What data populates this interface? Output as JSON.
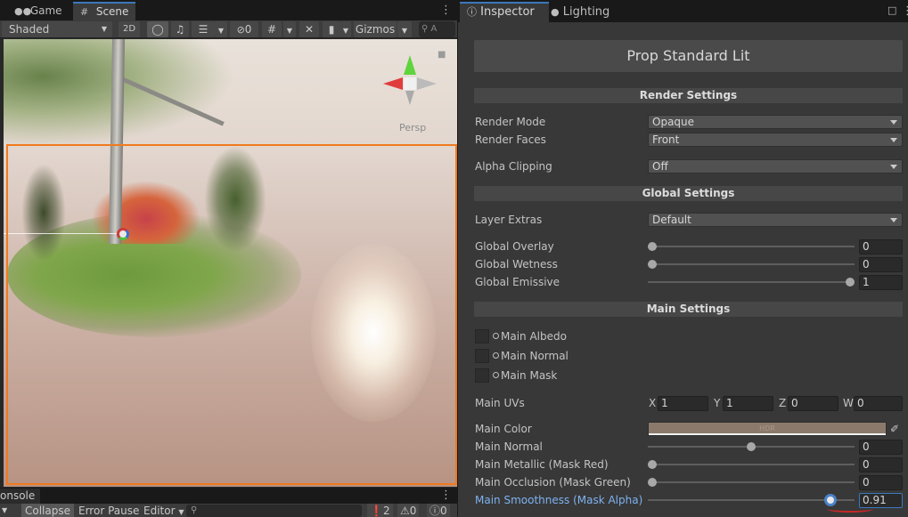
{
  "scene_panel": {
    "tabs": [
      {
        "label": "Game",
        "icon": "gamepad-icon"
      },
      {
        "label": "Scene",
        "icon": "grid-icon"
      }
    ],
    "toolbar": {
      "draw_mode": "Shaded",
      "mode_2d": "2D",
      "hidden_count": "0",
      "gizmos": "Gizmos",
      "search_placeholder": "A"
    },
    "viewport": {
      "projection_label": "Persp"
    }
  },
  "console": {
    "tab_label": "onsole",
    "collapse": "Collapse",
    "error_pause": "Error Pause",
    "editor": "Editor",
    "counts": {
      "errors": "2",
      "warnings": "0",
      "messages": "0"
    }
  },
  "inspector": {
    "tabs": {
      "inspector": "Inspector",
      "lighting": "Lighting"
    },
    "shader_name": "Prop Standard Lit",
    "render_settings": {
      "header": "Render Settings",
      "render_mode": {
        "label": "Render Mode",
        "value": "Opaque"
      },
      "render_faces": {
        "label": "Render Faces",
        "value": "Front"
      },
      "alpha_clipping": {
        "label": "Alpha Clipping",
        "value": "Off"
      }
    },
    "global_settings": {
      "header": "Global Settings",
      "layer_extras": {
        "label": "Layer Extras",
        "value": "Default"
      },
      "global_overlay": {
        "label": "Global Overlay",
        "value": "0",
        "level": 0
      },
      "global_wetness": {
        "label": "Global Wetness",
        "value": "0",
        "level": 0
      },
      "global_emissive": {
        "label": "Global Emissive",
        "value": "1",
        "level": 1
      }
    },
    "main_settings": {
      "header": "Main Settings",
      "textures": [
        "Main Albedo",
        "Main Normal",
        "Main Mask"
      ],
      "main_uvs": {
        "label": "Main UVs",
        "x": "1",
        "y": "1",
        "z": "0",
        "w": "0"
      },
      "main_color": {
        "label": "Main Color",
        "badge": "HDR",
        "color": "#8b7a6c"
      },
      "main_normal": {
        "label": "Main Normal",
        "value": "0",
        "level": 0.5
      },
      "main_metallic": {
        "label": "Main Metallic (Mask Red)",
        "value": "0",
        "level": 0
      },
      "main_occlusion": {
        "label": "Main Occlusion (Mask Green)",
        "value": "0",
        "level": 0
      },
      "main_smoothness": {
        "label": "Main Smoothness (Mask Alpha)",
        "value": "0.91",
        "level": 0.91
      }
    }
  },
  "colors": {
    "selection_outline": "#f07a1f",
    "active_tab_accent": "#3a79bb",
    "highlight_label": "#7eb2f1",
    "annotation_underline": "#c62828"
  }
}
